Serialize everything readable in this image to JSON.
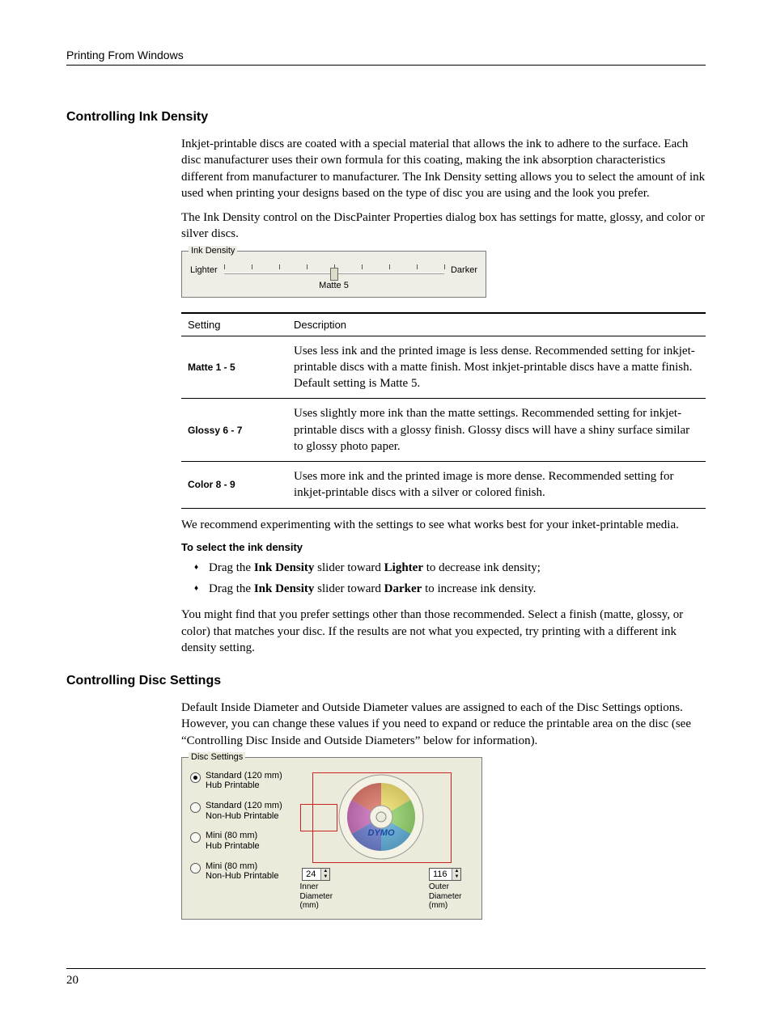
{
  "running_head": "Printing From Windows",
  "page_number": "20",
  "section1": {
    "title": "Controlling Ink Density",
    "para1": "Inkjet-printable discs are coated with a special material that allows the ink to adhere to the surface. Each disc manufacturer uses their own formula for this coating, making the ink absorption characteristics different from manufacturer to manufacturer. The Ink Density setting allows you to select the amount of ink used when printing your designs based on the type of disc you are using and the look you prefer.",
    "para2": "The Ink Density control on the DiscPainter Properties dialog box has settings for matte, glossy, and color or silver discs.",
    "figure": {
      "legend": "Ink Density",
      "lighter": "Lighter",
      "darker": "Darker",
      "caption": "Matte 5"
    },
    "table": {
      "headers": [
        "Setting",
        "Description"
      ],
      "rows": [
        {
          "setting": "Matte 1 - 5",
          "desc": "Uses less ink and the printed image is less dense. Recommended setting for inkjet-printable discs with a matte finish. Most inkjet-printable discs have a matte finish. Default setting is Matte 5."
        },
        {
          "setting": "Glossy 6 - 7",
          "desc": "Uses slightly more ink than the matte settings. Recommended setting for inkjet-printable discs with a glossy finish. Glossy discs will have a shiny surface similar to glossy photo paper."
        },
        {
          "setting": "Color 8 - 9",
          "desc": "Uses more ink and the printed image is more dense. Recommended setting for inkjet-printable discs with a silver or colored finish."
        }
      ]
    },
    "para3": "We recommend experimenting with the settings to see what works best for your inket-printable media.",
    "subhead": "To select the ink density",
    "bullets": [
      {
        "pre": "Drag the ",
        "b1": "Ink Density",
        "mid": " slider toward ",
        "b2": "Lighter",
        "post": " to decrease ink density;"
      },
      {
        "pre": "Drag the ",
        "b1": "Ink Density",
        "mid": " slider toward ",
        "b2": "Darker",
        "post": " to increase ink density."
      }
    ],
    "para4": "You might find that you prefer settings other than those recommended. Select a finish (matte, glossy, or color) that matches your disc. If the results are not what you expected, try printing with a different ink density setting."
  },
  "section2": {
    "title": "Controlling Disc Settings",
    "para1": "Default Inside Diameter and Outside Diameter values are assigned to each of the Disc Settings options. However, you can change these values if you need to expand or reduce the printable area on the disc (see “Controlling Disc Inside and Outside Diameters” below for information).",
    "figure": {
      "legend": "Disc Settings",
      "options": [
        {
          "line1": "Standard (120 mm)",
          "line2": "Hub Printable",
          "checked": true
        },
        {
          "line1": "Standard (120 mm)",
          "line2": "Non-Hub Printable",
          "checked": false
        },
        {
          "line1": "Mini (80 mm)",
          "line2": "Hub Printable",
          "checked": false
        },
        {
          "line1": "Mini (80 mm)",
          "line2": "Non-Hub Printable",
          "checked": false
        }
      ],
      "brand": "DYMO",
      "inner": {
        "value": "24",
        "label1": "Inner",
        "label2": "Diameter",
        "label3": "(mm)"
      },
      "outer": {
        "value": "116",
        "label1": "Outer",
        "label2": "Diameter",
        "label3": "(mm)"
      }
    }
  }
}
